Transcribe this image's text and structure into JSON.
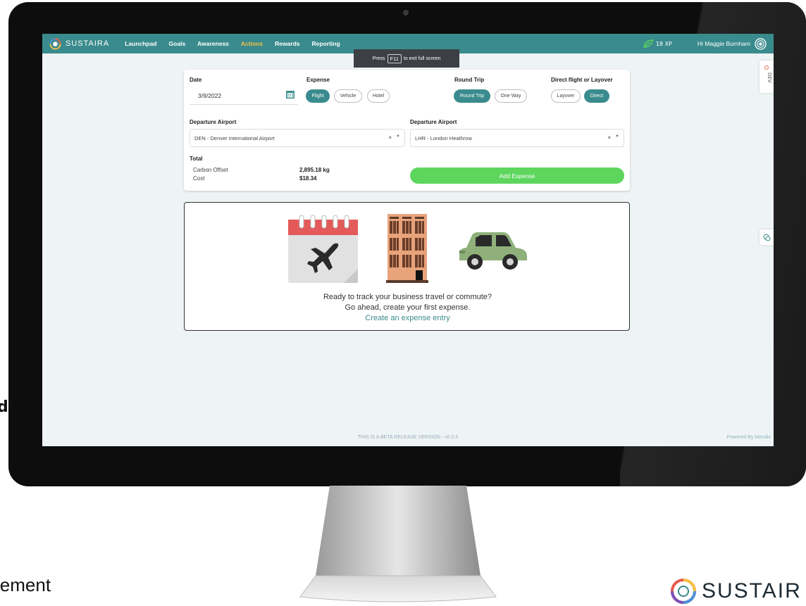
{
  "background": {
    "left_fragment": "d,",
    "bottom_fragment": "lement",
    "logo_text": "SUSTAIR"
  },
  "navbar": {
    "brand": "SUSTAIRA",
    "items": [
      {
        "label": "Launchpad",
        "active": false
      },
      {
        "label": "Goals",
        "active": false
      },
      {
        "label": "Awareness",
        "active": false
      },
      {
        "label": "Actions",
        "active": true
      },
      {
        "label": "Rewards",
        "active": false
      },
      {
        "label": "Reporting",
        "active": false
      }
    ],
    "xp": "18 XP",
    "greeting": "Hi Maggie Burnham"
  },
  "toast": {
    "prefix": "Press",
    "key": "F11",
    "suffix": "to exit full screen"
  },
  "dev_tab": {
    "label": "DEV"
  },
  "form": {
    "date_label": "Date",
    "date_value": "3/9/2022",
    "expense_label": "Expense",
    "expense_options": [
      "Flight",
      "Vehicle",
      "Hotel"
    ],
    "expense_selected": "Flight",
    "round_trip_label": "Round Trip",
    "round_trip_options": [
      "Round Trip",
      "One Way"
    ],
    "round_trip_selected": "Round Trip",
    "layover_label": "Direct flight or Layover",
    "layover_options": [
      "Layover",
      "Direct"
    ],
    "layover_selected": "Direct",
    "departure_label": "Departure Airport",
    "departure_value": "DEN - Denver International Airport",
    "arrival_label": "Departure Airport",
    "arrival_value": "LHR - London Heathrow",
    "total_label": "Total",
    "carbon_label": "Carbon Offset",
    "carbon_value": "2,895.18 kg",
    "cost_label": "Cost",
    "cost_value": "$18.34",
    "add_button": "Add Expense"
  },
  "empty_state": {
    "line1": "Ready to track your business travel or commute?",
    "line2": "Go ahead, create your first expense.",
    "link": "Create an expense entry"
  },
  "footer": {
    "beta": "THIS IS A BETA RELEASE VERSION - v0.0.5",
    "powered": "Powered By Mendix"
  },
  "colors": {
    "brand": "#3a8b8d",
    "active_nav": "#f5c04a",
    "add_button": "#5ed65e",
    "screen_bg": "#eef4f5"
  }
}
